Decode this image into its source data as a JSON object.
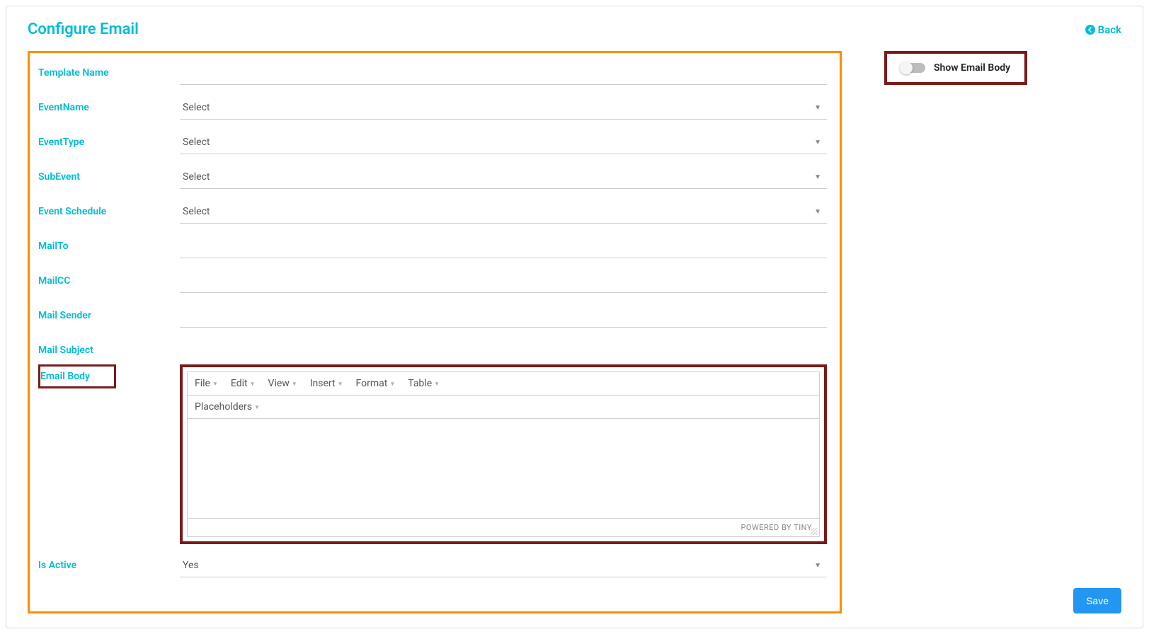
{
  "header": {
    "title": "Configure Email",
    "back_label": "Back"
  },
  "fields": {
    "template_name": {
      "label": "Template Name",
      "value": ""
    },
    "event_name": {
      "label": "EventName",
      "value": "Select"
    },
    "event_type": {
      "label": "EventType",
      "value": "Select"
    },
    "sub_event": {
      "label": "SubEvent",
      "value": "Select"
    },
    "event_schedule": {
      "label": "Event Schedule",
      "value": "Select"
    },
    "mail_to": {
      "label": "MailTo",
      "value": ""
    },
    "mail_cc": {
      "label": "MailCC",
      "value": ""
    },
    "mail_sender": {
      "label": "Mail Sender",
      "value": ""
    },
    "mail_subject": {
      "label": "Mail Subject",
      "value": ""
    },
    "email_body": {
      "label": "Email Body"
    },
    "is_active": {
      "label": "Is Active",
      "value": "Yes"
    }
  },
  "editor": {
    "menus": [
      "File",
      "Edit",
      "View",
      "Insert",
      "Format",
      "Table"
    ],
    "secondary": "Placeholders",
    "footer": "POWERED BY TINY"
  },
  "side": {
    "show_email_body": "Show Email Body"
  },
  "actions": {
    "save": "Save"
  }
}
